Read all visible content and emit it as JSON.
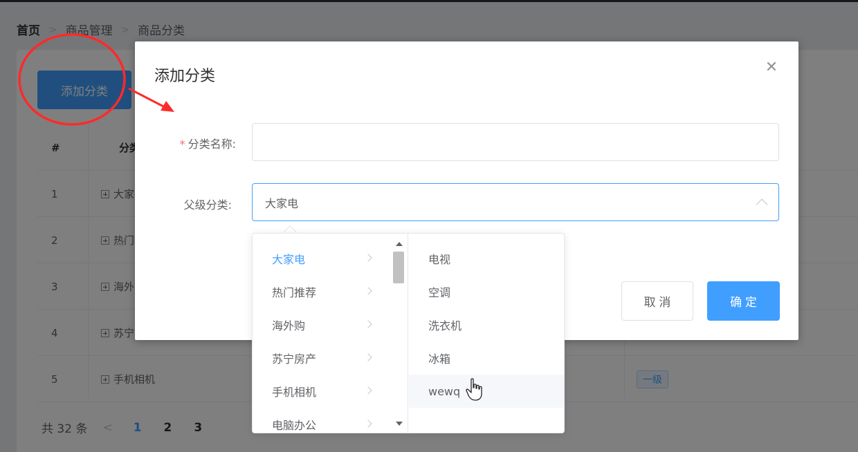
{
  "breadcrumb": [
    "首页",
    "商品管理",
    "商品分类"
  ],
  "toolbar": {
    "add_label": "添加分类"
  },
  "table": {
    "header": {
      "index": "#",
      "name": "分类"
    },
    "rows": [
      {
        "index": "1",
        "name": "大家"
      },
      {
        "index": "2",
        "name": "热门"
      },
      {
        "index": "3",
        "name": "海外"
      },
      {
        "index": "4",
        "name": "苏宁"
      },
      {
        "index": "5",
        "name": "手机相机",
        "level": "一级"
      }
    ]
  },
  "pagination": {
    "total": "共 32 条",
    "pages": [
      "1",
      "2",
      "3"
    ],
    "active": "1"
  },
  "dialog": {
    "title": "添加分类",
    "name_label": "分类名称:",
    "required_mark": "*",
    "name_value": "",
    "parent_label": "父级分类:",
    "parent_value": "大家电",
    "cancel_label": "取 消",
    "ok_label": "确 定"
  },
  "cascader": {
    "level1": [
      "大家电",
      "热门推荐",
      "海外购",
      "苏宁房产",
      "手机相机",
      "电脑办公"
    ],
    "level1_active": "大家电",
    "level2": [
      "电视",
      "空调",
      "洗衣机",
      "冰箱",
      "wewq"
    ],
    "level2_hover": "wewq"
  },
  "colors": {
    "primary": "#409eff",
    "annotation": "#ff2a2a",
    "overlay": "rgba(0,0,0,0.5)"
  }
}
